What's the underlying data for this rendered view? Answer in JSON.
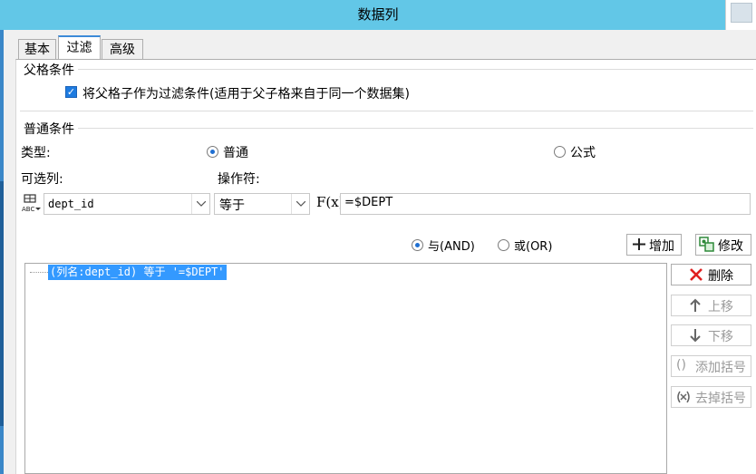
{
  "window": {
    "title": "数据列"
  },
  "tabs": [
    {
      "label": "基本",
      "active": false
    },
    {
      "label": "过滤",
      "active": true
    },
    {
      "label": "高级",
      "active": false
    }
  ],
  "parent_condition": {
    "group_label": "父格条件",
    "checkbox_label": "将父格子作为过滤条件(适用于父子格来自于同一个数据集)",
    "checked": true
  },
  "normal_condition": {
    "group_label": "普通条件",
    "type_label": "类型:",
    "type_options": [
      {
        "label": "普通",
        "selected": true
      },
      {
        "label": "公式",
        "selected": false
      }
    ],
    "column_label": "可选列:",
    "operator_label": "操作符:",
    "column_value": "dept_id",
    "operator_value": "等于",
    "formula_icon": "F(x)",
    "value_input": "=$DEPT",
    "logic_options": [
      {
        "label": "与(AND)",
        "selected": true
      },
      {
        "label": "或(OR)",
        "selected": false
      }
    ],
    "add_button": "增加",
    "modify_button": "修改"
  },
  "condition_list": {
    "items": [
      "(列名:dept_id) 等于 '=$DEPT'"
    ]
  },
  "side_buttons": {
    "delete": "删除",
    "up": "上移",
    "down": "下移",
    "add_bracket": "添加括号",
    "remove_bracket": "去掉括号"
  },
  "colors": {
    "titlebar": "#62c7e7",
    "selection": "#3399ff",
    "accent_red": "#e02020"
  }
}
